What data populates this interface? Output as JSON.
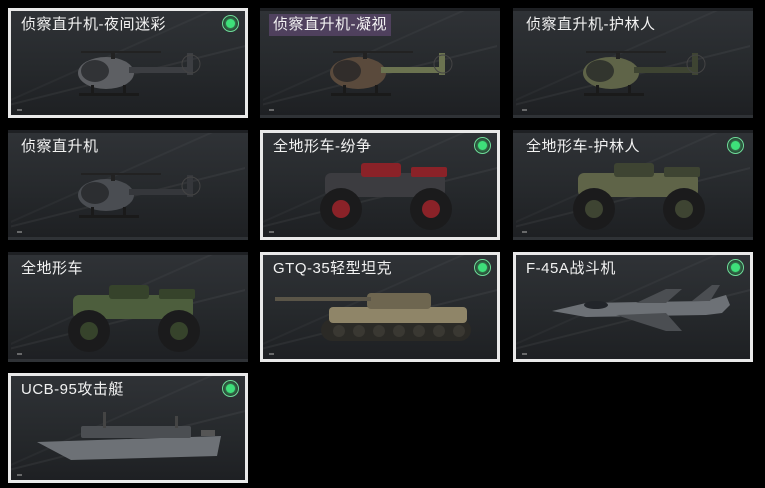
{
  "vehicles": [
    {
      "label": "侦察直升机-夜间迷彩",
      "selected": true,
      "owned": true,
      "kind": "heli",
      "camo": "night"
    },
    {
      "label": "侦察直升机-凝视",
      "selected": false,
      "owned": false,
      "kind": "heli",
      "camo": "gaze"
    },
    {
      "label": "侦察直升机-护林人",
      "selected": false,
      "owned": false,
      "kind": "heli",
      "camo": "ranger"
    },
    {
      "label": "侦察直升机",
      "selected": false,
      "owned": false,
      "kind": "heli",
      "camo": "plain"
    },
    {
      "label": "全地形车-纷争",
      "selected": true,
      "owned": true,
      "kind": "atv",
      "camo": "strife"
    },
    {
      "label": "全地形车-护林人",
      "selected": false,
      "owned": true,
      "kind": "atv",
      "camo": "ranger"
    },
    {
      "label": "全地形车",
      "selected": false,
      "owned": false,
      "kind": "atv",
      "camo": "green"
    },
    {
      "label": "GTQ-35轻型坦克",
      "selected": true,
      "owned": true,
      "kind": "tank",
      "camo": "desert"
    },
    {
      "label": "F-45A战斗机",
      "selected": true,
      "owned": true,
      "kind": "jet",
      "camo": "grey"
    },
    {
      "label": "UCB-95攻击艇",
      "selected": true,
      "owned": true,
      "kind": "boat",
      "camo": "grey"
    }
  ],
  "colors": {
    "owned_badge": "#3ee07a",
    "selected_border": "#e9e9e9",
    "card_bg": "#2a2d30"
  },
  "icons": {
    "owned": "owned-indicator-icon"
  }
}
